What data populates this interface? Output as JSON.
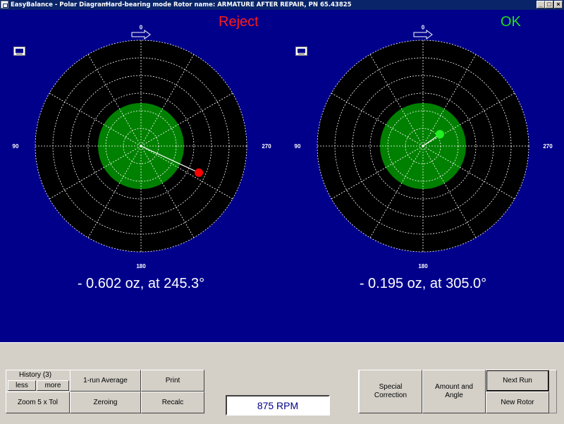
{
  "window": {
    "title_app": "EasyBalance - Polar Diagram",
    "title_mode": "Hard-bearing mode",
    "title_rotor": "Rotor name: ARMATURE AFTER REPAIR, PN 65.43825",
    "min_glyph": "_",
    "max_glyph": "□",
    "close_glyph": "×"
  },
  "diagrams": [
    {
      "status": "Reject",
      "status_color": "#ff1a1a",
      "readout": "- 0.602 oz, at 245.3°",
      "point_color": "#ff0000",
      "angle_deg": 245.3,
      "amount_oz": 0.602
    },
    {
      "status": "OK",
      "status_color": "#22dd22",
      "readout": "- 0.195 oz, at 305.0°",
      "point_color": "#22ee22",
      "angle_deg": 305.0,
      "amount_oz": 0.195
    }
  ],
  "angle_labels": {
    "top": "0",
    "left": "90",
    "right": "270",
    "bottom": "180"
  },
  "icons": {
    "arrow": "right-arrow-icon",
    "monitor": "monitor-icon"
  },
  "colors": {
    "background": "#00008b",
    "plot": "#000000",
    "tolerance_zone": "#008000",
    "grid": "#ffffff"
  },
  "controls": {
    "history_label": "History (3)",
    "less": "less",
    "more": "more",
    "zoom": "Zoom 5 x Tol",
    "average": "1-run Average",
    "zeroing": "Zeroing",
    "print": "Print",
    "recalc": "Recalc",
    "rpm": "875 RPM",
    "special_line1": "Special",
    "special_line2": "Correction",
    "amount_line1": "Amount and",
    "amount_line2": "Angle",
    "next_run": "Next Run",
    "new_rotor": "New Rotor"
  }
}
